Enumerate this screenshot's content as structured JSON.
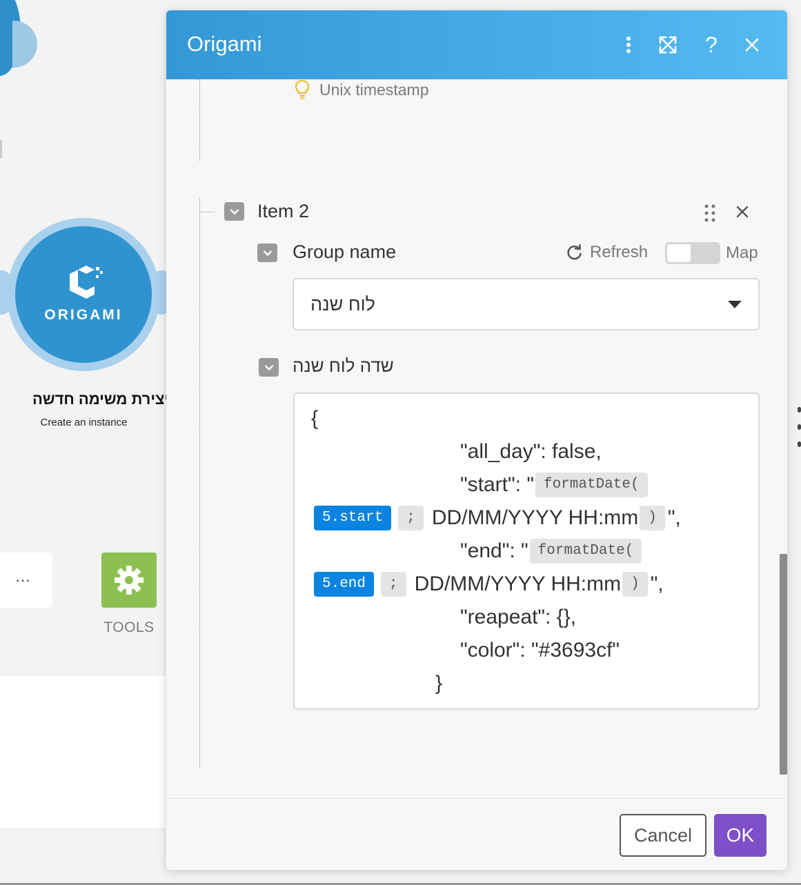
{
  "background": {
    "module": {
      "logo_text": "ORIGAMI",
      "title": "יצירת משימה חדשה",
      "subtitle": "Create an instance"
    },
    "more_label": "···",
    "tools_label": "TOOLS"
  },
  "dialog": {
    "title": "Origami",
    "hint": "Unix timestamp",
    "item": {
      "title": "Item 2"
    },
    "group": {
      "label": "Group name",
      "refresh_label": "Refresh",
      "map_label": "Map",
      "map_enabled": false,
      "selected_value": "לוח שנה"
    },
    "field": {
      "label": "שדה לוח שנה",
      "code": {
        "l1": "{",
        "l2": "\"all_day\": false,",
        "l3_text": "\"start\": \"",
        "l3_fn": "formatDate(",
        "l4_var": "5.start",
        "l4_sep": ";",
        "l4_fmt": "DD/MM/YYYY HH:mm",
        "l4_close": ")",
        "l4_tail": "\",",
        "l5_text": "\"end\": \"",
        "l5_fn": "formatDate(",
        "l6_var": "5.end",
        "l6_sep": ";",
        "l6_fmt": "DD/MM/YYYY HH:mm",
        "l6_close": ")",
        "l6_tail": "\",",
        "l7": "\"reapeat\": {},",
        "l8": "\"color\": \"#3693cf\"",
        "l9": "}"
      }
    },
    "footer": {
      "cancel_label": "Cancel",
      "ok_label": "OK"
    }
  },
  "colors": {
    "header_start": "#3498d6",
    "header_end": "#55baf2",
    "ok_button": "#7e4fc7",
    "variable_chip": "#0a84e0",
    "tools_tile": "#8cc152"
  }
}
